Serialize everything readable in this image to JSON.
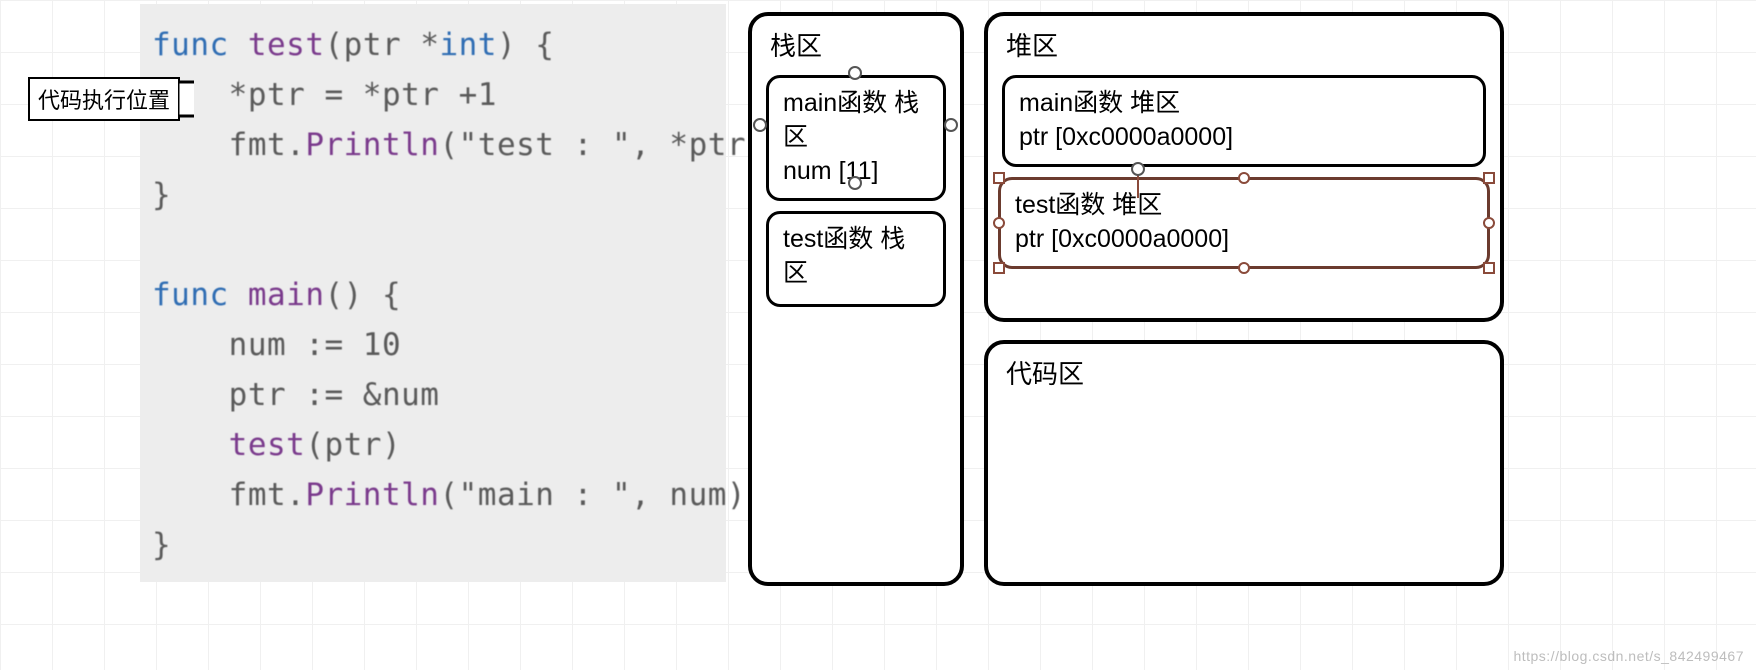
{
  "exec_pointer_label": "代码执行位置",
  "code": {
    "func_kw": "func",
    "test_name": "test",
    "test_sig_open": "(",
    "test_param": "ptr ",
    "star": "*",
    "int_type": "int",
    "test_sig_close": ") {",
    "test_line1": "*ptr = *ptr +1",
    "test_line2_prefix": "fmt.",
    "test_line2_fn": "Println",
    "test_line2_args": "(\"test : \", *ptr)",
    "brace_close": "}",
    "main_name": "main",
    "main_sig": "() {",
    "main_l1": "num := 10",
    "main_l2": "ptr := &num",
    "main_l3_fn": "test",
    "main_l3_args": "(ptr)",
    "main_l4_prefix": "fmt.",
    "main_l4_fn": "Println",
    "main_l4_args": "(\"main : \", num)"
  },
  "stack": {
    "title": "栈区",
    "main_box_l1": "main函数 栈区",
    "main_box_l2": "num [11]",
    "test_box_l1": "test函数 栈区"
  },
  "heap": {
    "title": "堆区",
    "main_box_l1": "main函数 堆区",
    "main_box_l2": "ptr [0xc0000a0000]",
    "test_box_l1": "test函数 堆区",
    "test_box_l2": "ptr [0xc0000a0000]"
  },
  "code_area": {
    "title": "代码区"
  },
  "watermark": "https://blog.csdn.net/s_842499467"
}
